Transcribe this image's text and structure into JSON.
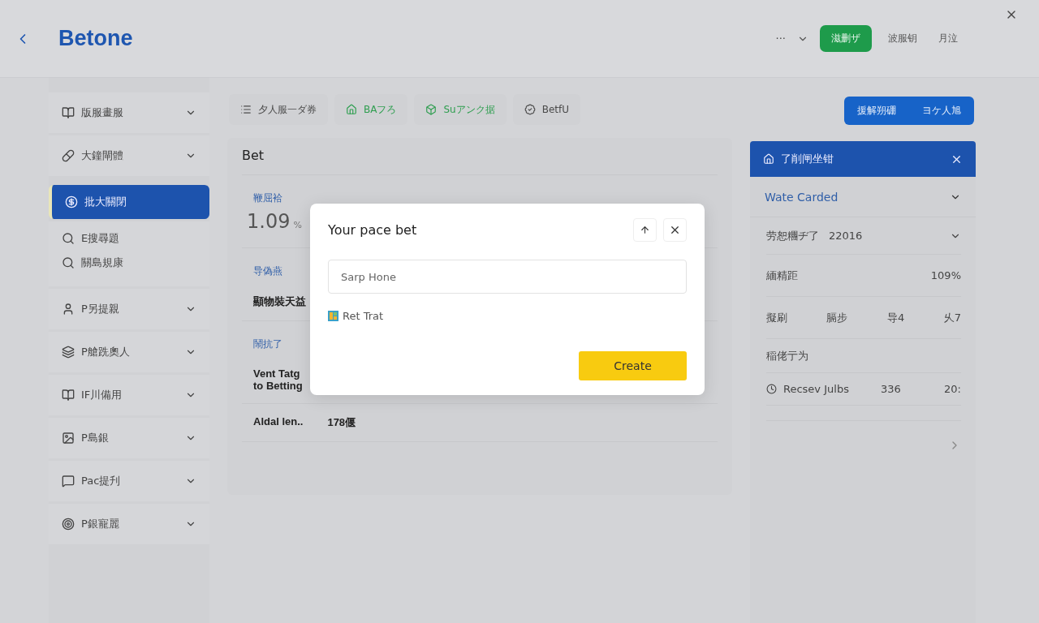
{
  "header": {
    "logo": "Betone",
    "more": "···",
    "actions": [
      {
        "label": "滋删ザ",
        "kind": "primary"
      },
      {
        "label": "波服钥",
        "kind": "link"
      },
      {
        "label": "月泣",
        "kind": "link"
      }
    ]
  },
  "sidebar": {
    "items": [
      {
        "label": "版服畫服",
        "selected": false
      },
      {
        "label": "大鐘閘體",
        "selected": false
      },
      {
        "label": "批大關閉",
        "selected": true,
        "children": [
          {
            "label": "E搜尋題"
          },
          {
            "label": "關島規康"
          }
        ]
      },
      {
        "label": "P另提親",
        "selected": false
      },
      {
        "label": "P艙跣奧人",
        "selected": false
      },
      {
        "label": "IF川備用",
        "selected": false
      },
      {
        "label": "P島銀",
        "selected": false
      },
      {
        "label": "Pac提刋",
        "selected": false
      },
      {
        "label": "P銀寵麗",
        "selected": false
      }
    ]
  },
  "tabs": [
    {
      "label": "夕人服一ダ券",
      "color": "#4a4a4a"
    },
    {
      "label": "BAフろ",
      "color": "#2e9e4f"
    },
    {
      "label": "Suアンク据",
      "color": "#2e9e4f"
    },
    {
      "label": "BetfU",
      "color": "#4a4a4a"
    }
  ],
  "card": {
    "title": "Bet",
    "stat": {
      "label": "鞭屈袷",
      "value": "1.09",
      "unit": "%"
    },
    "sections": [
      {
        "heading": "导偽燕",
        "rows": [
          {
            "cells": [
              "顯物裝天益"
            ]
          }
        ]
      },
      {
        "heading": "鬧抗了",
        "rows": [
          {
            "cells": [
              "Vent Tatg to Betting"
            ]
          },
          {
            "cells": [
              "Aldal len..",
              "178偃"
            ]
          }
        ]
      }
    ]
  },
  "dialog": {
    "title": "Your pace bet",
    "placeholder": "Sarp Hone",
    "option": "Ret Trat",
    "button": "Create"
  },
  "button_group": [
    "援解朔硼",
    "ヨケ人旭"
  ],
  "panel": {
    "title": "了削闸坐钳",
    "subtitle": "Wate Carded",
    "rows": [
      {
        "kind": "select",
        "label": "劳恕糰ヂ了",
        "value": "22016"
      },
      {
        "kind": "pair",
        "label": "緬精距",
        "value": "109%"
      },
      {
        "kind": "cols",
        "items": [
          "擬刷",
          "膈步",
          "导4",
          "乆7"
        ]
      },
      {
        "kind": "label",
        "label": "稲佬亍为"
      },
      {
        "kind": "timer",
        "label": "Recsev Julbs",
        "value": "336",
        "time": "20:"
      },
      {
        "kind": "more"
      }
    ]
  }
}
